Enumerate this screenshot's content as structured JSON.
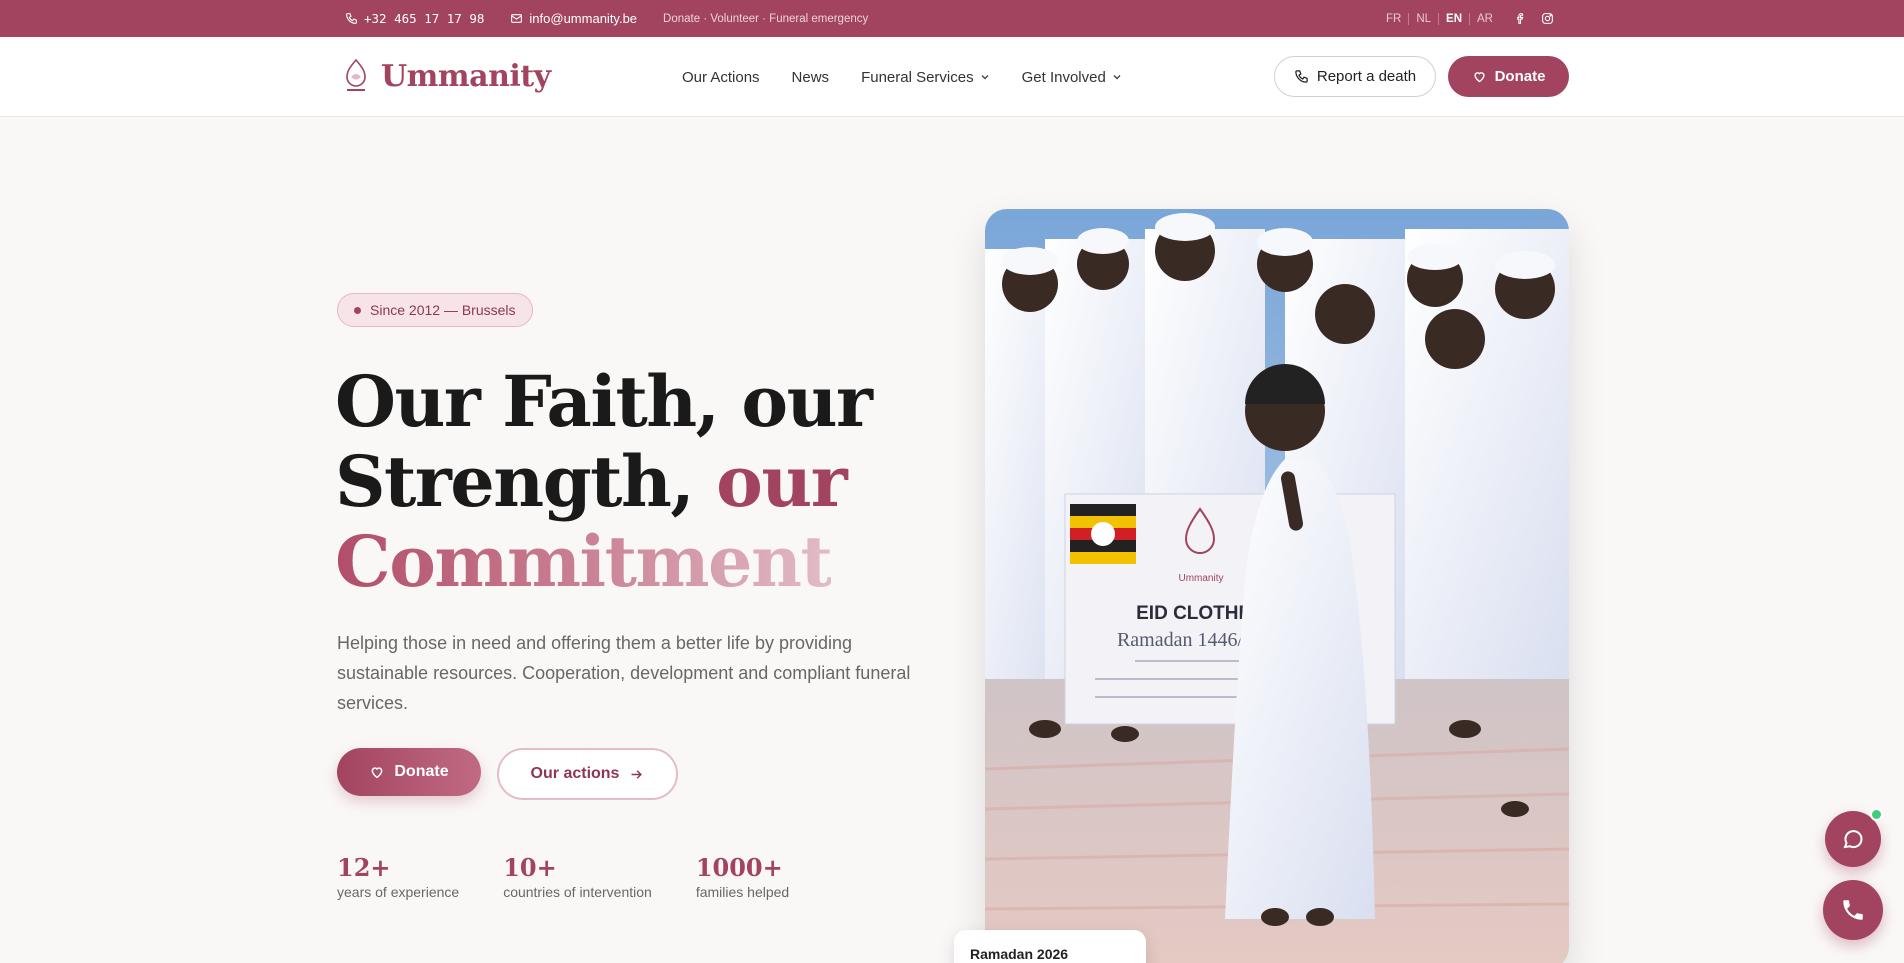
{
  "topbar": {
    "phone": "+32 465 17 17 98",
    "email": "info@ummanity.be",
    "links": "Donate · Volunteer · Funeral emergency",
    "languages": [
      "FR",
      "NL",
      "EN",
      "AR"
    ],
    "active_language": "EN",
    "background": "#a2445f"
  },
  "nav": {
    "logo_text": "Ummanity",
    "menu": [
      {
        "label": "Our Actions",
        "dropdown": false
      },
      {
        "label": "News",
        "dropdown": false
      },
      {
        "label": "Funeral Services",
        "dropdown": true
      },
      {
        "label": "Get Involved",
        "dropdown": true
      }
    ],
    "report_label": "Report a death",
    "donate_label": "Donate"
  },
  "hero": {
    "badge": "Since 2012 — Brussels",
    "headline_line1": "Our Faith, our",
    "headline_line2_a": "Strength,",
    "headline_line2_b": "our",
    "headline_line3": "Commitment",
    "lead": "Helping those in need and offering them a better life by providing sustainable resources. Cooperation, development and compliant funeral services.",
    "donate_label": "Donate",
    "actions_label": "Our actions",
    "stats": [
      {
        "value": "12+",
        "label": "years of experience"
      },
      {
        "value": "10+",
        "label": "countries of intervention"
      },
      {
        "value": "1000+",
        "label": "families helped"
      }
    ]
  },
  "photo": {
    "banner_title": "EID CLOTHES",
    "banner_subtitle": "Ramadan 1446/2025",
    "banner_brand": "Ummanity",
    "card_label": "Ramadan 2026"
  },
  "colors": {
    "accent": "#a2445f",
    "online": "#3fcf7c"
  }
}
